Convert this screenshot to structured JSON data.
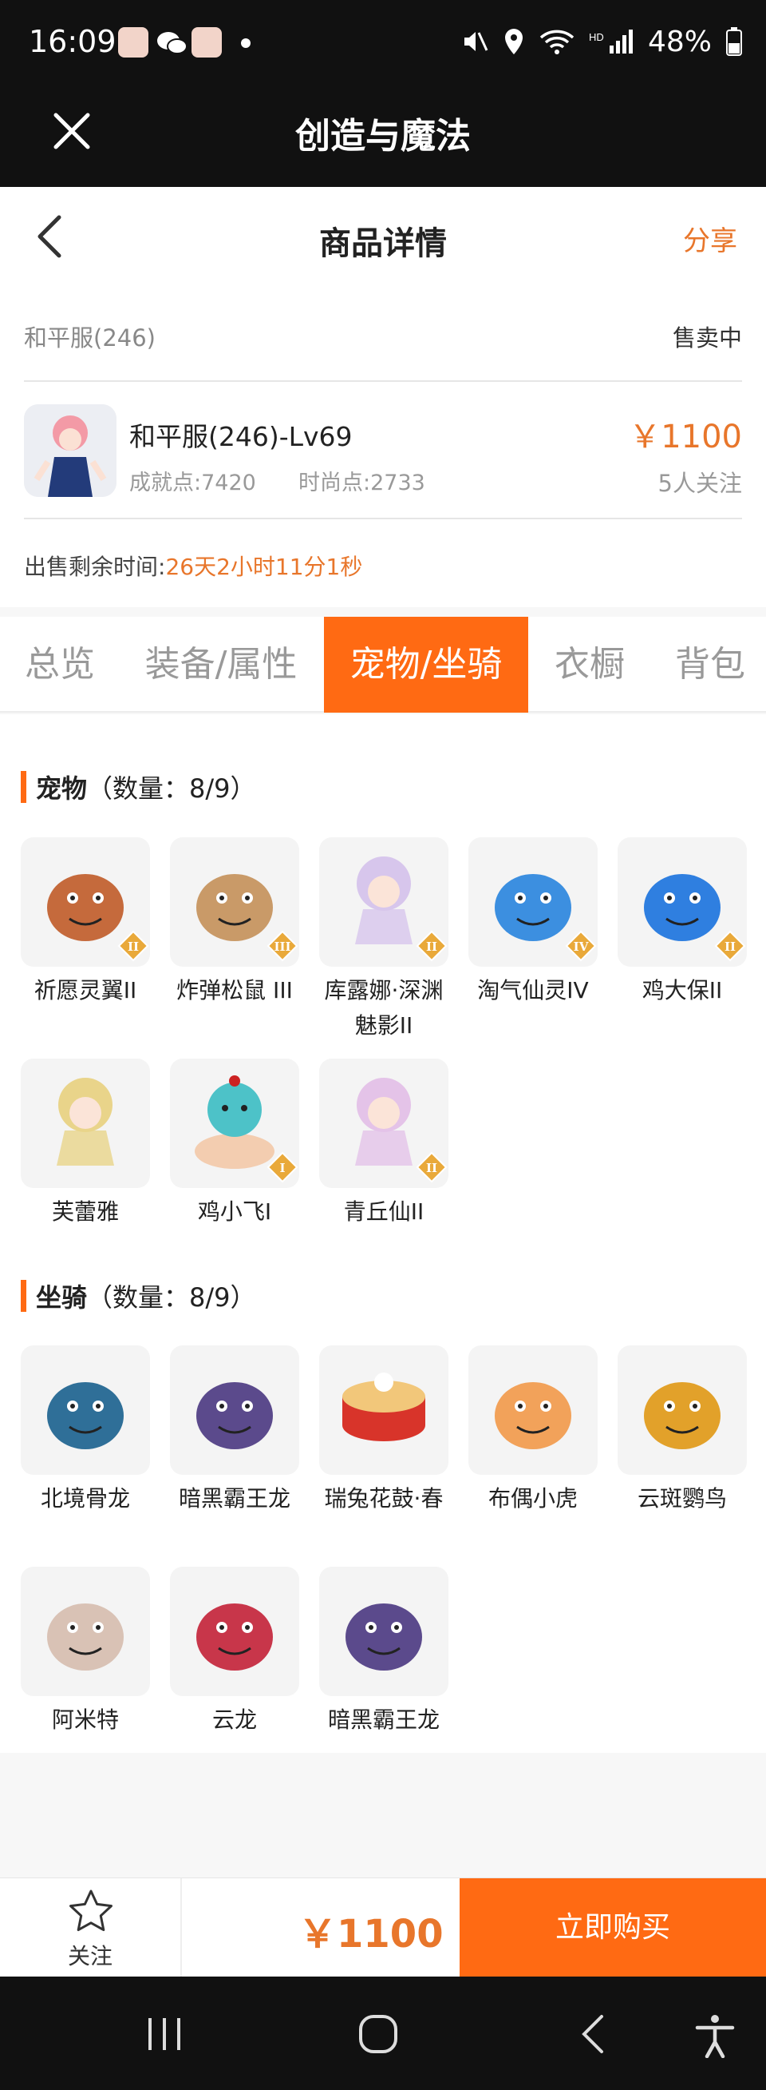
{
  "status_bar": {
    "time": "16:09",
    "battery": "48%"
  },
  "app_bar": {
    "title": "创造与魔法"
  },
  "detail_header": {
    "title": "商品详情",
    "share": "分享"
  },
  "listing": {
    "server": "和平服(246)",
    "sale_status": "售卖中",
    "character_name": "和平服(246)-Lv69",
    "achievement_points": "成就点:7420",
    "fashion_points": "时尚点:2733",
    "price": "￥1100",
    "followers": "5人关注",
    "remaining_label": "出售剩余时间:",
    "remaining_value": "26天2小时11分1秒"
  },
  "tabs": [
    {
      "label": "总览",
      "active": false
    },
    {
      "label": "装备/属性",
      "active": false
    },
    {
      "label": "宠物/坐骑",
      "active": true
    },
    {
      "label": "衣橱",
      "active": false
    },
    {
      "label": "背包",
      "active": false
    }
  ],
  "pets": {
    "title": "宠物",
    "count": "（数量：8/9）",
    "items": [
      {
        "name": "祈愿灵翼II",
        "badge": "II",
        "icon": "griffin-pet-icon",
        "color": "#c56a3c"
      },
      {
        "name": "炸弹松鼠 III",
        "badge": "III",
        "icon": "squirrel-pet-icon",
        "color": "#c99a68"
      },
      {
        "name": "库露娜·深渊魅影II",
        "badge": "II",
        "icon": "kuluna-pet-icon",
        "color": "#d7c6ec"
      },
      {
        "name": "淘气仙灵IV",
        "badge": "IV",
        "icon": "blue-dog-pet-icon",
        "color": "#3c8fe0"
      },
      {
        "name": "鸡大保II",
        "badge": "II",
        "icon": "blue-bird-pet-icon",
        "color": "#2f7fe0"
      },
      {
        "name": "芙蕾雅",
        "badge": "",
        "icon": "freya-pet-icon",
        "color": "#e9d48a"
      },
      {
        "name": "鸡小飞I",
        "badge": "I",
        "icon": "chick-pet-icon",
        "color": "#4dc2c8"
      },
      {
        "name": "青丘仙II",
        "badge": "II",
        "icon": "fox-fairy-pet-icon",
        "color": "#e4c3e8"
      }
    ]
  },
  "mounts": {
    "title": "坐骑",
    "count": "（数量：8/9）",
    "items": [
      {
        "name": "北境骨龙",
        "icon": "bone-dragon-mount-icon",
        "color": "#2f6f98"
      },
      {
        "name": "暗黑霸王龙",
        "icon": "dark-trex-mount-icon",
        "color": "#5b4a8c"
      },
      {
        "name": "瑞兔花鼓·春",
        "icon": "rabbit-drum-mount-icon",
        "color": "#d8342a"
      },
      {
        "name": "布偶小虎",
        "icon": "tiger-doll-mount-icon",
        "color": "#f2a25a"
      },
      {
        "name": "云斑鹦鸟",
        "icon": "parrot-mount-icon",
        "color": "#e2a12a"
      },
      {
        "name": "阿米特",
        "icon": "ammit-mount-icon",
        "color": "#d9c2b5"
      },
      {
        "name": "云龙",
        "icon": "cloud-dragon-mount-icon",
        "color": "#c8364a"
      },
      {
        "name": "暗黑霸王龙",
        "icon": "dark-trex-mount-icon",
        "color": "#5b4a8c"
      }
    ]
  },
  "bottom_bar": {
    "follow": "关注",
    "price": "￥1100",
    "buy": "立即购买"
  },
  "colors": {
    "accent": "#ff6a13",
    "price": "#e8762b",
    "dark": "#111111"
  }
}
